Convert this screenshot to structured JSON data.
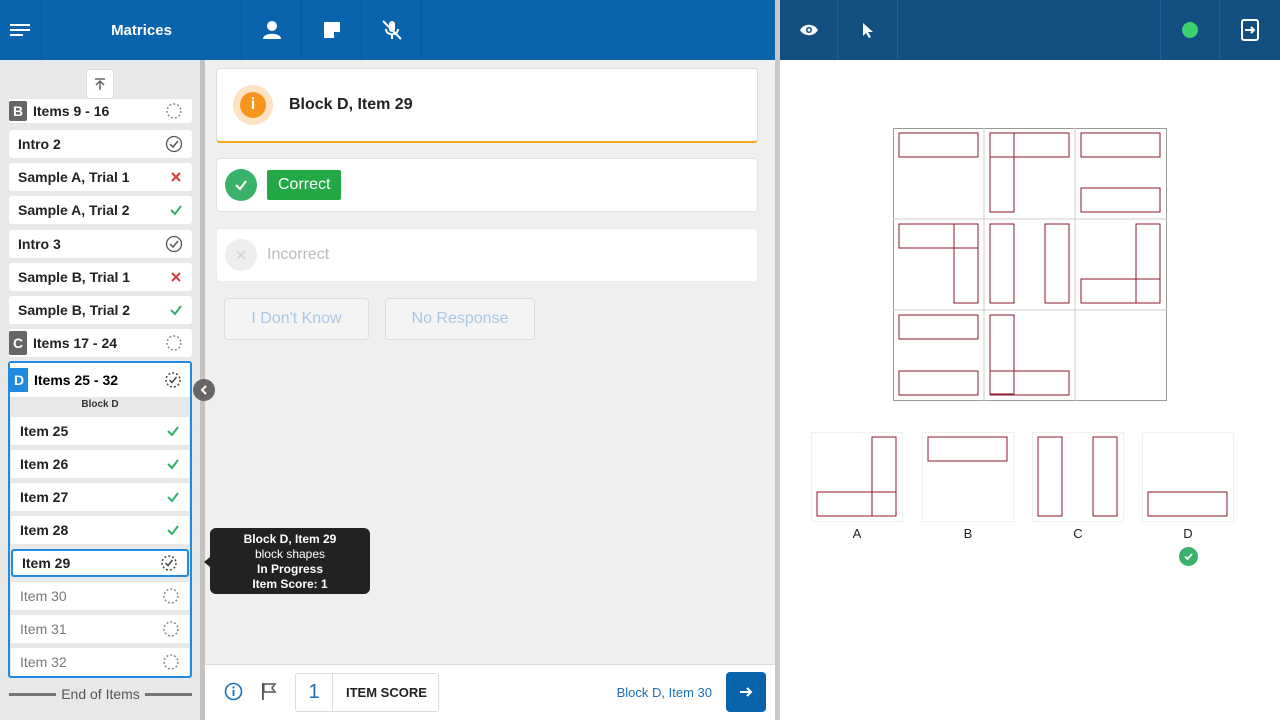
{
  "app": {
    "title": "Matrices"
  },
  "sidebar": {
    "items": [
      {
        "badge": "B",
        "label": "Items 9 - 16",
        "status": "not-started"
      },
      {
        "label": "Intro 2",
        "status": "complete"
      },
      {
        "label": "Sample A, Trial 1",
        "status": "incorrect"
      },
      {
        "label": "Sample A, Trial 2",
        "status": "correct"
      },
      {
        "label": "Intro 3",
        "status": "complete"
      },
      {
        "label": "Sample B, Trial 1",
        "status": "incorrect"
      },
      {
        "label": "Sample B, Trial 2",
        "status": "correct"
      },
      {
        "badge": "C",
        "label": "Items 17 - 24",
        "status": "not-started"
      }
    ],
    "block_d": {
      "badge": "D",
      "label": "Items 25 - 32",
      "subtitle": "Block D",
      "items": [
        {
          "label": "Item 25",
          "status": "correct"
        },
        {
          "label": "Item 26",
          "status": "correct"
        },
        {
          "label": "Item 27",
          "status": "correct"
        },
        {
          "label": "Item 28",
          "status": "correct"
        },
        {
          "label": "Item 29",
          "status": "in-progress"
        },
        {
          "label": "Item 30",
          "status": "not-started"
        },
        {
          "label": "Item 31",
          "status": "not-started"
        },
        {
          "label": "Item 32",
          "status": "not-started"
        }
      ]
    },
    "end_label": "End of Items"
  },
  "tooltip": {
    "title": "Block D, Item 29",
    "description": "block shapes",
    "status": "In Progress",
    "score": "Item Score: 1"
  },
  "item": {
    "title": "Block D, Item 29",
    "correct_label": "Correct",
    "incorrect_label": "Incorrect",
    "dont_know_label": "I Don't Know",
    "no_response_label": "No Response"
  },
  "footer": {
    "score_value": "1",
    "score_label": "ITEM SCORE",
    "next_item_label": "Block D, Item 30"
  },
  "stimulus": {
    "choices": [
      "A",
      "B",
      "C",
      "D"
    ],
    "selected_choice": "D"
  },
  "colors": {
    "primary": "#0a63ad",
    "right_bar": "#124e80",
    "correct": "#22a845",
    "warning": "#f7941d",
    "shape_stroke": "#8b1a2b",
    "status_online": "#3bd16f"
  }
}
